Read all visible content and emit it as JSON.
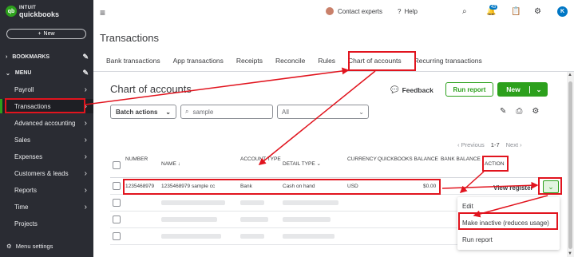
{
  "brand": {
    "line1": "INTUIT",
    "line2": "quickbooks",
    "mark": "qb"
  },
  "sidebar": {
    "new_label": "New",
    "bookmarks_label": "BOOKMARKS",
    "menu_label": "MENU",
    "items": [
      {
        "label": "Payroll"
      },
      {
        "label": "Transactions"
      },
      {
        "label": "Advanced accounting"
      },
      {
        "label": "Sales"
      },
      {
        "label": "Expenses"
      },
      {
        "label": "Customers & leads"
      },
      {
        "label": "Reports"
      },
      {
        "label": "Time"
      },
      {
        "label": "Projects"
      }
    ],
    "menu_settings": "Menu settings"
  },
  "topbar": {
    "contact": "Contact experts",
    "help": "Help",
    "notif_count": "43",
    "user_initial": "K"
  },
  "page_title": "Transactions",
  "tabs": [
    "Bank transactions",
    "App transactions",
    "Receipts",
    "Reconcile",
    "Rules",
    "Chart of accounts",
    "Recurring transactions"
  ],
  "section": {
    "title": "Chart of accounts",
    "feedback": "Feedback",
    "run_report": "Run report",
    "new": "New",
    "batch_actions": "Batch actions",
    "search_value": "sample",
    "filter_value": "All"
  },
  "pager": {
    "previous": "Previous",
    "range": "1-7",
    "next": "Next"
  },
  "table": {
    "headers": {
      "number": "NUMBER",
      "name": "NAME",
      "account_type": "ACCOUNT TYPE",
      "detail_type": "DETAIL TYPE",
      "currency": "CURRENCY",
      "qb_balance": "QUICKBOOKS BALANCE",
      "bank_balance": "BANK BALANCE",
      "action": "ACTION"
    },
    "row1": {
      "number": "1235468979",
      "name": "1235468979 sample cc",
      "account_type": "Bank",
      "detail_type": "Cash on hand",
      "currency": "USD",
      "qb_balance": "$0.00",
      "action": "View register"
    }
  },
  "action_menu": [
    "Edit",
    "Make inactive (reduces usage)",
    "Run report"
  ],
  "colors": {
    "accent": "#2ca01c",
    "annotation": "#e1141e",
    "sidebar": "#2a2c33"
  }
}
